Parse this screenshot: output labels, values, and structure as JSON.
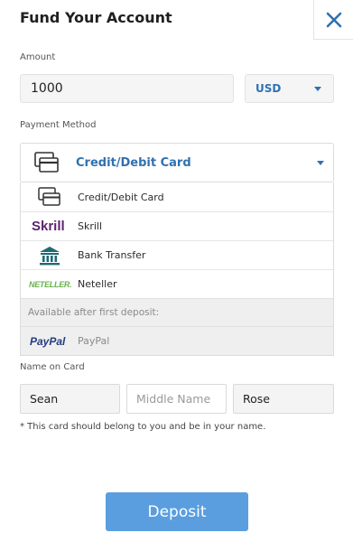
{
  "header": {
    "title": "Fund Your Account",
    "close_icon": "close-icon"
  },
  "amount": {
    "label": "Amount",
    "value": "1000"
  },
  "currency": {
    "value": "USD"
  },
  "payment_method": {
    "label": "Payment Method",
    "selected": "Credit/Debit Card",
    "options": [
      {
        "label": "Credit/Debit Card",
        "icon": "credit-card-icon"
      },
      {
        "label": "Skrill",
        "icon": "skrill-logo",
        "logo_text": "Skrill"
      },
      {
        "label": "Bank Transfer",
        "icon": "bank-icon"
      },
      {
        "label": "Neteller",
        "icon": "neteller-logo",
        "logo_text": "NETELLER."
      }
    ],
    "disabled_note": "Available after first deposit:",
    "disabled_options": [
      {
        "label": "PayPal",
        "icon": "paypal-logo",
        "logo_text": "PayPal"
      }
    ]
  },
  "name_on_card": {
    "label": "Name on Card",
    "first": "Sean",
    "middle_placeholder": "Middle Name",
    "last": "Rose"
  },
  "note": "* This card should belong to you and be in your name.",
  "deposit_button": {
    "label": "Deposit"
  },
  "colors": {
    "accent": "#2f71b1",
    "button": "#5a9ee0",
    "close": "#2f71b1",
    "skrill": "#5d2473",
    "bank": "#1e6b73",
    "neteller": "#6ab04c",
    "paypal": "#253b80"
  }
}
